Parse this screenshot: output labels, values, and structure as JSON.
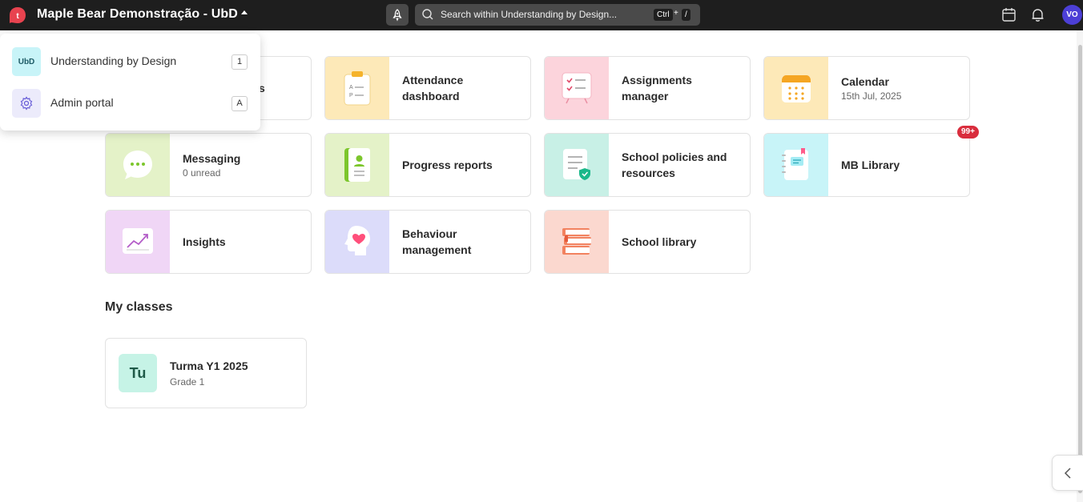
{
  "topbar": {
    "org_title": "Maple Bear Demonstração - UbD",
    "search_placeholder": "Search within Understanding by Design...",
    "shortcut_ctrl": "Ctrl",
    "shortcut_plus": "+",
    "shortcut_slash": "/",
    "avatar_initials": "VO",
    "icons": [
      "app-logo-icon",
      "chevron-up-icon",
      "rocket-icon",
      "search-icon",
      "calendar-icon",
      "bell-icon"
    ]
  },
  "dropdown": {
    "items": [
      {
        "icon_text": "UbD",
        "label": "Understanding by Design",
        "key": "1"
      },
      {
        "icon": "gear-icon",
        "label": "Admin portal",
        "key": "A"
      }
    ]
  },
  "tiles": [
    {
      "title": "Attendance dashboard",
      "subtitle": "",
      "icon": "attendance-sheet-icon",
      "bg": "#fde9b8"
    },
    {
      "title": "Assignments manager",
      "subtitle": "",
      "icon": "checklist-board-icon",
      "bg": "#fcd4dc"
    },
    {
      "title": "Calendar",
      "subtitle": "15th Jul, 2025",
      "icon": "calendar-icon",
      "bg": "#fde9b8"
    },
    {
      "title": "Messaging",
      "subtitle": "0 unread",
      "icon": "chat-bubble-icon",
      "bg": "#e4f2c8"
    },
    {
      "title": "Progress reports",
      "subtitle": "",
      "icon": "report-book-icon",
      "bg": "#e4f2c8"
    },
    {
      "title": "School policies and resources",
      "subtitle": "",
      "icon": "policy-document-icon",
      "bg": "#c8f0e6"
    },
    {
      "title": "MB Library",
      "subtitle": "",
      "icon": "notebook-icon",
      "bg": "#c8f4f8",
      "badge": "99+"
    },
    {
      "title": "Insights",
      "subtitle": "",
      "icon": "chart-trend-icon",
      "bg": "#f0d6f6"
    },
    {
      "title": "Behaviour management",
      "subtitle": "",
      "icon": "head-heart-icon",
      "bg": "#dcdcfa"
    },
    {
      "title": "School library",
      "subtitle": "",
      "icon": "books-stack-icon",
      "bg": "#fbd8cf"
    }
  ],
  "hidden_tile_fragment": "s",
  "my_classes": {
    "heading": "My classes",
    "classes": [
      {
        "initials": "Tu",
        "name": "Turma Y1 2025",
        "grade": "Grade 1"
      }
    ]
  },
  "colors": {
    "topbar_bg": "#1e1e1e",
    "accent_avatar": "#4c3fd6",
    "badge": "#d92d3d",
    "logo": "#e8434f"
  }
}
